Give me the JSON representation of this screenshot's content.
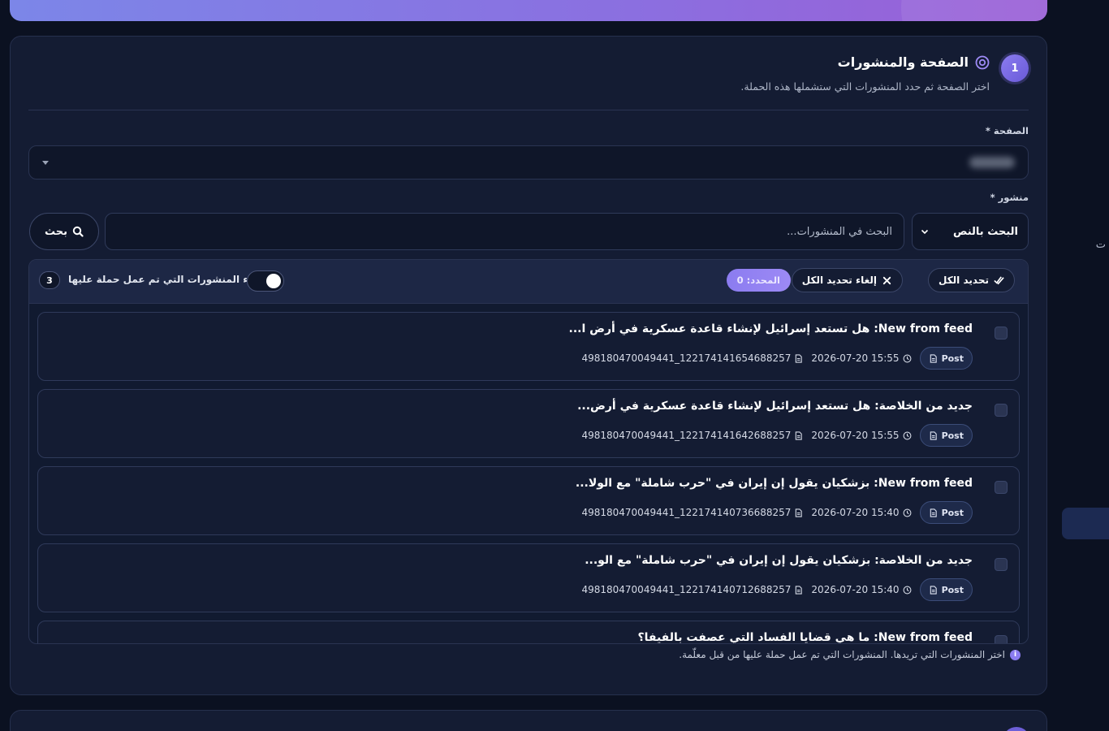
{
  "section": {
    "step_number": "1",
    "title": "الصفحة والمنشورات",
    "subtitle": "اختر الصفحة ثم حدد المنشورات التي ستشملها هذه الحملة."
  },
  "page_field": {
    "label": "الصفحة *"
  },
  "post_field": {
    "label": "منشور *",
    "search_mode": "البحث بالنص",
    "search_placeholder": "البحث في المنشورات...",
    "search_button": "بحث"
  },
  "toolbar": {
    "select_all": "تحديد الكل",
    "deselect_all": "إلغاء تحديد الكل",
    "selected_count": "المحدد: 0",
    "hide_label": "إخفاء المنشورات التي تم عمل حملة عليها",
    "hidden_count": "3"
  },
  "posts": [
    {
      "title": "New from feed: هل تستعد إسرائيل لإنشاء قاعدة عسكرية في أرض ا...",
      "type": "Post",
      "datetime": "2026-07-20 15:55",
      "post_id": "498180470049441_122174141654688257"
    },
    {
      "title": "جديد من الخلاصة: هل تستعد إسرائيل لإنشاء قاعدة عسكرية في أرض...",
      "type": "Post",
      "datetime": "2026-07-20 15:55",
      "post_id": "498180470049441_122174141642688257"
    },
    {
      "title": "New from feed: بزشكيان يقول إن إيران في \"حرب شاملة\" مع الولا...",
      "type": "Post",
      "datetime": "2026-07-20 15:40",
      "post_id": "498180470049441_122174140736688257"
    },
    {
      "title": "جديد من الخلاصة: بزشكيان يقول إن إيران في \"حرب شاملة\" مع الو...",
      "type": "Post",
      "datetime": "2026-07-20 15:40",
      "post_id": "498180470049441_122174140712688257"
    },
    {
      "title": "New from feed: ما هي قضايا الفساد التي عصفت بالفيفا؟",
      "type": "",
      "datetime": "",
      "post_id": ""
    }
  ],
  "hint": "اختر المنشورات التي تريدها. المنشورات التي تم عمل حملة عليها من قبل معلّمة.",
  "side_text": "ت"
}
